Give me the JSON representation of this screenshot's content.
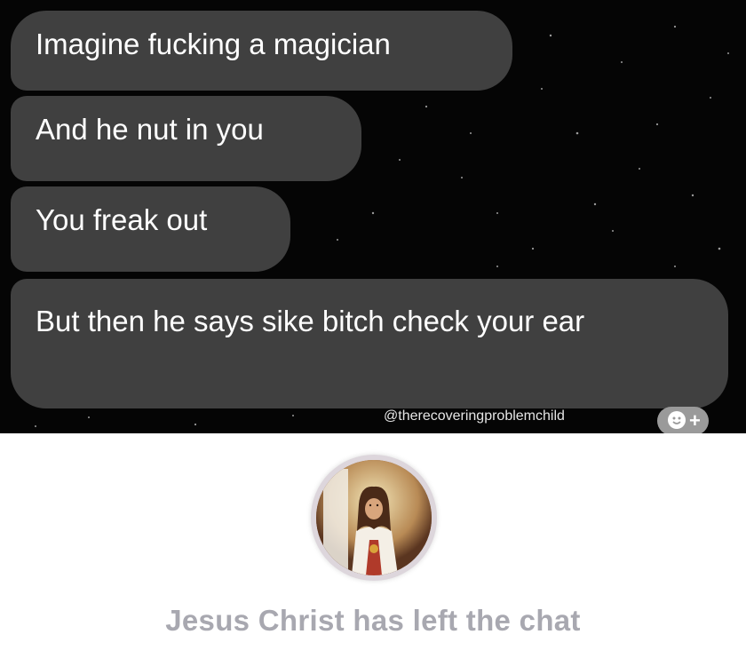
{
  "messages": [
    {
      "text": "Imagine fucking a magician"
    },
    {
      "text": "And he nut in you"
    },
    {
      "text": "You freak out"
    },
    {
      "text": "But then he says sike bitch check your ear"
    }
  ],
  "watermark": "@therecoveringproblemchild",
  "reaction_button": {
    "icon": "add-emoji-icon",
    "plus": "+"
  },
  "system_event": {
    "avatar_icon": "jesus-avatar",
    "text": "Jesus Christ has left the chat"
  },
  "colors": {
    "chat_background": "#050505",
    "bubble": "#404040",
    "bubble_text": "#ffffff",
    "system_text": "#a8a8b0"
  }
}
